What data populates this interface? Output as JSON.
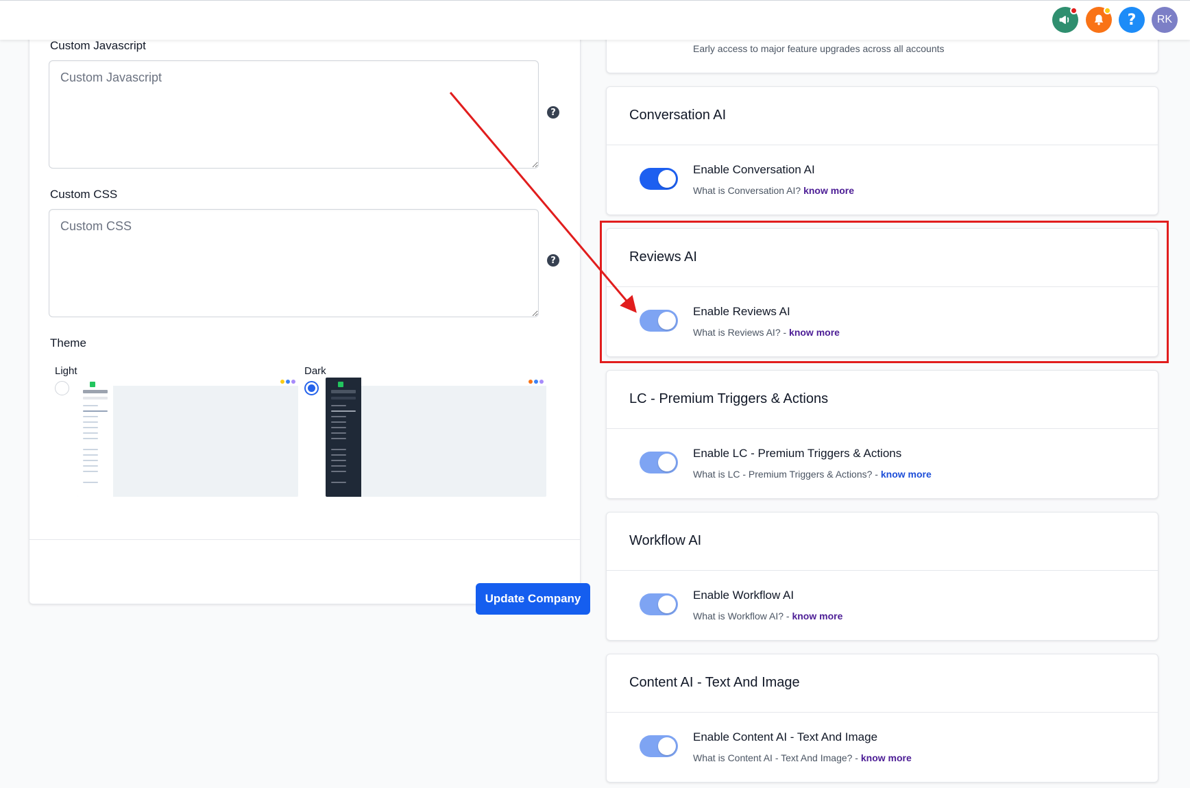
{
  "header": {
    "icons": [
      {
        "name": "announcement-icon",
        "bg": "#2f8f6f",
        "badge": "#e11d1d"
      },
      {
        "name": "notification-bell-icon",
        "bg": "#f97316",
        "badge": "#facc15"
      },
      {
        "name": "help-icon",
        "bg": "#1d8cf8",
        "glyph": "?"
      },
      {
        "name": "user-avatar",
        "bg": "#7c7fc6",
        "initials": "RK"
      }
    ]
  },
  "custom_code": {
    "js_label": "Custom Javascript",
    "js_placeholder": "Custom Javascript",
    "css_label": "Custom CSS",
    "css_placeholder": "Custom CSS",
    "help_glyph": "?"
  },
  "theme": {
    "label": "Theme",
    "options": [
      {
        "label": "Light",
        "selected": false
      },
      {
        "label": "Dark",
        "selected": true
      }
    ]
  },
  "update_button": "Update Company",
  "colors": {
    "accent": "#155eef",
    "toggle_on": "#1d5ff0",
    "toggle_off_light": "#7ea4f3",
    "annotation_red": "#e11d1d"
  },
  "early_access": {
    "description": "Early access to major feature upgrades across all accounts"
  },
  "features": [
    {
      "title": "Conversation AI",
      "label": "Enable Conversation AI",
      "desc": "What is Conversation AI? ",
      "link": "know more",
      "enabled": true
    },
    {
      "title": "Reviews AI",
      "label": "Enable Reviews AI",
      "desc": "What is Reviews AI? - ",
      "link": "know more",
      "enabled": false
    },
    {
      "title": "LC - Premium Triggers & Actions",
      "label": "Enable LC - Premium Triggers & Actions",
      "desc": "What is LC - Premium Triggers & Actions? - ",
      "link": "know more",
      "enabled": false
    },
    {
      "title": "Workflow AI",
      "label": "Enable Workflow AI",
      "desc": "What is Workflow AI? - ",
      "link": "know more",
      "enabled": false
    },
    {
      "title": "Content AI - Text And Image",
      "label": "Enable Content AI - Text And Image",
      "desc": "What is Content AI - Text And Image? - ",
      "link": "know more",
      "enabled": false
    }
  ]
}
